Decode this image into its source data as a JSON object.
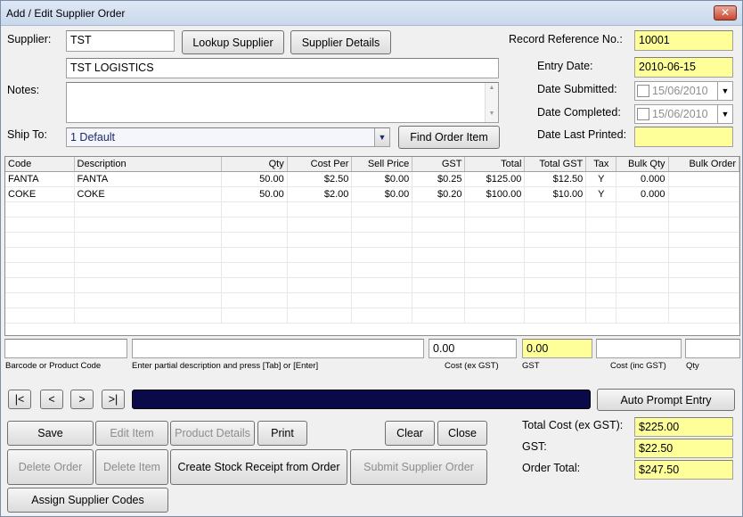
{
  "window": {
    "title": "Add / Edit Supplier Order",
    "close_glyph": "✕"
  },
  "supplier": {
    "label": "Supplier:",
    "code": "TST",
    "name": "TST LOGISTICS",
    "lookup_btn": "Lookup Supplier",
    "details_btn": "Supplier Details"
  },
  "notes": {
    "label": "Notes:",
    "value": ""
  },
  "ship_to": {
    "label": "Ship To:",
    "value": "1   Default",
    "find_btn": "Find Order Item"
  },
  "record": {
    "ref_label": "Record Reference No.:",
    "ref_value": "10001",
    "entry_label": "Entry Date:",
    "entry_value": "2010-06-15",
    "submitted_label": "Date Submitted:",
    "submitted_value": "15/06/2010",
    "completed_label": "Date Completed:",
    "completed_value": "15/06/2010",
    "printed_label": "Date Last Printed:",
    "printed_value": ""
  },
  "grid": {
    "columns": [
      "Code",
      "Description",
      "Qty",
      "Cost Per",
      "Sell Price",
      "GST",
      "Total",
      "Total GST",
      "Tax",
      "Bulk Qty",
      "Bulk Order"
    ],
    "rows": [
      [
        "FANTA",
        "FANTA",
        "50.00",
        "$2.50",
        "$0.00",
        "$0.25",
        "$125.00",
        "$12.50",
        "Y",
        "0.000",
        ""
      ],
      [
        "COKE",
        "COKE",
        "50.00",
        "$2.00",
        "$0.00",
        "$0.20",
        "$100.00",
        "$10.00",
        "Y",
        "0.000",
        ""
      ]
    ]
  },
  "entry": {
    "barcode_label": "Barcode or Product Code",
    "desc_label": "Enter partial description and press [Tab] or [Enter]",
    "cost_ex_value": "0.00",
    "cost_ex_label": "Cost (ex GST)",
    "gst_value": "0.00",
    "gst_label": "GST",
    "cost_inc_label": "Cost (inc GST)",
    "qty_label": "Qty"
  },
  "nav": {
    "first": "|<",
    "prev": "<",
    "next": ">",
    "last": ">|",
    "auto_prompt": "Auto Prompt Entry"
  },
  "buttons": {
    "save": "Save",
    "edit_item": "Edit Item",
    "product_details": "Product Details",
    "print": "Print",
    "clear": "Clear",
    "close": "Close",
    "delete_order": "Delete Order",
    "delete_item": "Delete Item",
    "create_receipt": "Create Stock Receipt from Order",
    "submit_order": "Submit Supplier Order",
    "assign_codes": "Assign Supplier Codes"
  },
  "totals": {
    "cost_label": "Total Cost (ex GST):",
    "cost_value": "$225.00",
    "gst_label": "GST:",
    "gst_value": "$22.50",
    "order_label": "Order Total:",
    "order_value": "$247.50"
  }
}
